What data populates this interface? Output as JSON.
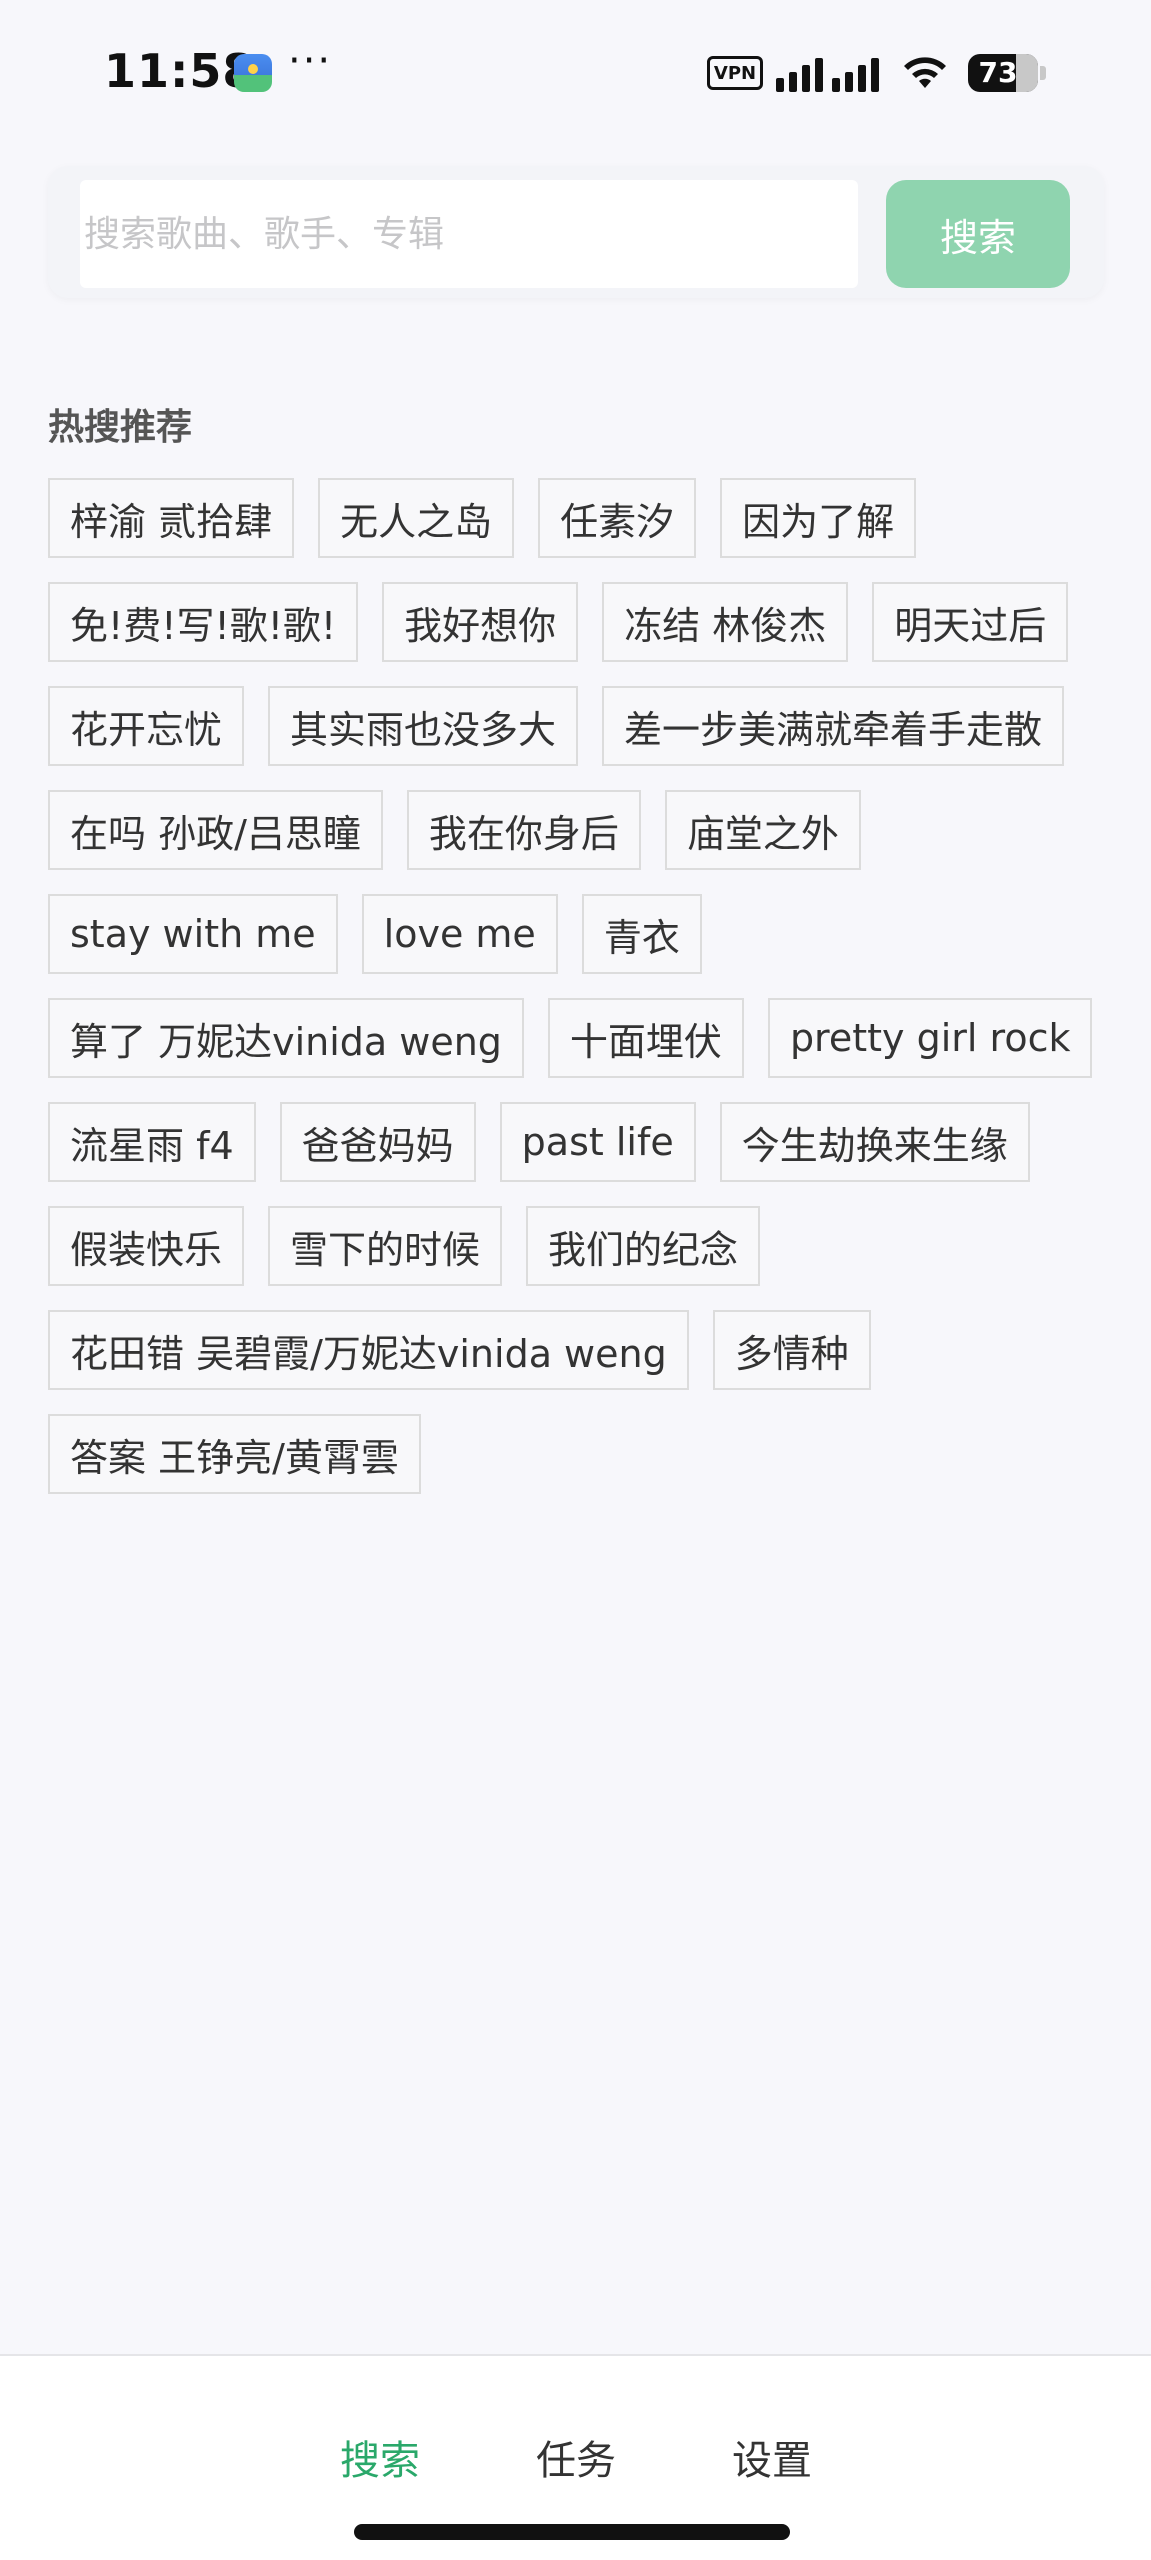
{
  "status_bar": {
    "time": "11:58",
    "more": "···",
    "vpn": "VPN",
    "battery_level": "73"
  },
  "search": {
    "placeholder": "搜索歌曲、歌手、专辑",
    "value": "",
    "button_label": "搜索"
  },
  "hot": {
    "title": "热搜推荐",
    "tags": [
      "梓渝 贰拾肆",
      "无人之岛",
      "任素汐",
      "因为了解",
      "免!费!写!歌!歌!",
      "我好想你",
      "冻结 林俊杰",
      "明天过后",
      "花开忘忧",
      "其实雨也没多大",
      "差一步美满就牵着手走散",
      "在吗 孙政/吕思瞳",
      "我在你身后",
      "庙堂之外",
      "stay with me",
      "love me",
      "青衣",
      "算了 万妮达vinida weng",
      "十面埋伏",
      "pretty girl rock",
      "流星雨 f4",
      "爸爸妈妈",
      "past life",
      "今生劫换来生缘",
      "假装快乐",
      "雪下的时候",
      "我们的纪念",
      "花田错 吴碧霞/万妮达vinida weng",
      "多情种",
      "答案 王铮亮/黄霄雲"
    ]
  },
  "tabs": {
    "search": "搜索",
    "tasks": "任务",
    "settings": "设置",
    "active": "search",
    "active_color": "#2aa86a"
  },
  "colors": {
    "accent_button": "#8fd4af",
    "background": "#f7f7fb"
  }
}
